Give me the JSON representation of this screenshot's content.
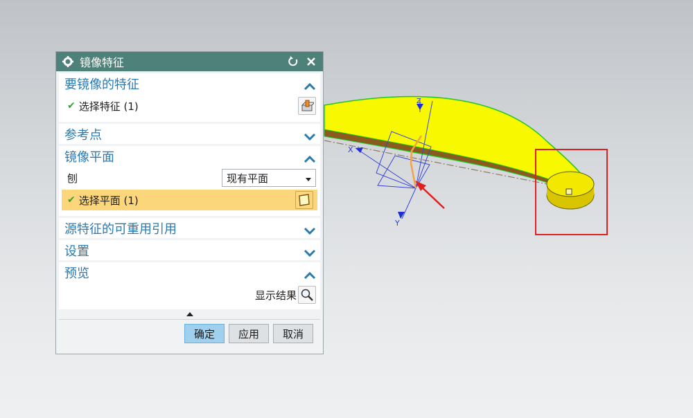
{
  "dialog": {
    "title": "镜像特征",
    "title_icon": "gear-icon",
    "reset_icon": "reset-icon",
    "close_icon": "close-icon"
  },
  "sections": {
    "features": {
      "label": "要镜像的特征",
      "state": "expanded",
      "select_label": "选择特征 (1)"
    },
    "ref_point": {
      "label": "参考点",
      "state": "collapsed"
    },
    "mirror_plane": {
      "label": "镜像平面",
      "state": "expanded",
      "plane_label": "刨",
      "plane_option": "现有平面",
      "select_label": "选择平面 (1)"
    },
    "reuse": {
      "label": "源特征的可重用引用",
      "state": "collapsed"
    },
    "settings": {
      "label": "设置",
      "state": "collapsed"
    },
    "preview": {
      "label": "预览",
      "state": "expanded",
      "show_result": "显示结果"
    }
  },
  "buttons": {
    "ok": "确定",
    "apply": "应用",
    "cancel": "取消"
  },
  "viewport": {
    "axis_x": "X",
    "axis_y": "Y",
    "axis_z": "Z",
    "part_color": "#f8f800",
    "highlight_color": "#e02020"
  }
}
